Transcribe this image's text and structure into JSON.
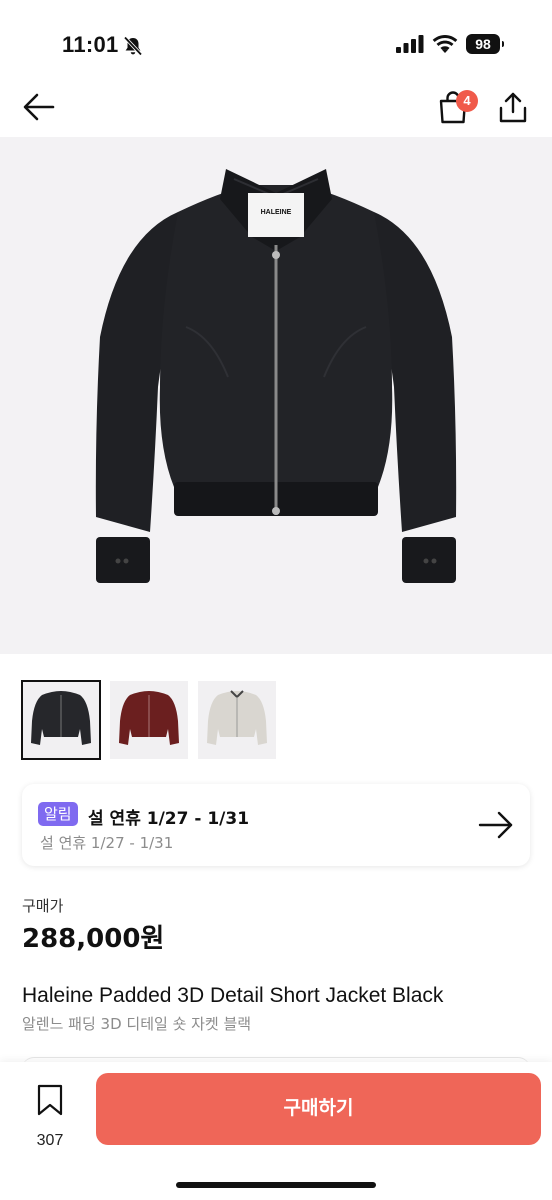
{
  "status_bar": {
    "time": "11:01",
    "battery": "98"
  },
  "nav": {
    "back_icon": "arrow-left-icon",
    "bag_icon": "shopping-bag-icon",
    "bag_badge_count": "4",
    "share_icon": "share-icon"
  },
  "hero": {
    "brand_tag": "HALEINE"
  },
  "thumbnails": [
    {
      "color": "#26272b",
      "selected": true
    },
    {
      "color": "#6b1f1f",
      "selected": false
    },
    {
      "color": "#d9d6d0",
      "selected": false
    }
  ],
  "notice": {
    "badge": "알림",
    "title": "설 연휴 1/27 - 1/31",
    "subtitle": "설 연휴 1/27 - 1/31",
    "arrow_icon": "arrow-right-icon"
  },
  "price": {
    "label": "구매가",
    "value": "288,000원"
  },
  "product": {
    "name": "Haleine Padded 3D Detail Short Jacket Black",
    "name_ko": "알렌느 패딩 3D 디테일 숏 자켓 블랙"
  },
  "bottom_bar": {
    "bookmark_count": "307",
    "buy_label": "구매하기"
  },
  "colors": {
    "accent": "#ef6658",
    "badge": "#7f6af0",
    "cart_badge": "#f05a4a"
  }
}
